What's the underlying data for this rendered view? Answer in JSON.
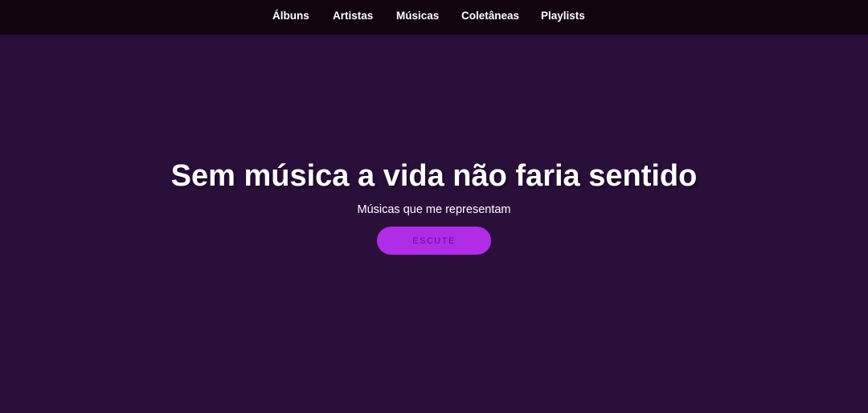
{
  "nav": {
    "items": [
      {
        "label": "Álbuns"
      },
      {
        "label": "Artistas"
      },
      {
        "label": "Músicas"
      },
      {
        "label": "Coletâneas"
      },
      {
        "label": "Playlists"
      }
    ]
  },
  "hero": {
    "title": "Sem música a vida não faria sentido",
    "subtitle": "Músicas que me representam",
    "button_label": "ESCUTE"
  },
  "colors": {
    "background": "#2b0f3b",
    "navbar": "#12040f",
    "button": "#b02ce6",
    "button_text": "#5e0f86"
  }
}
